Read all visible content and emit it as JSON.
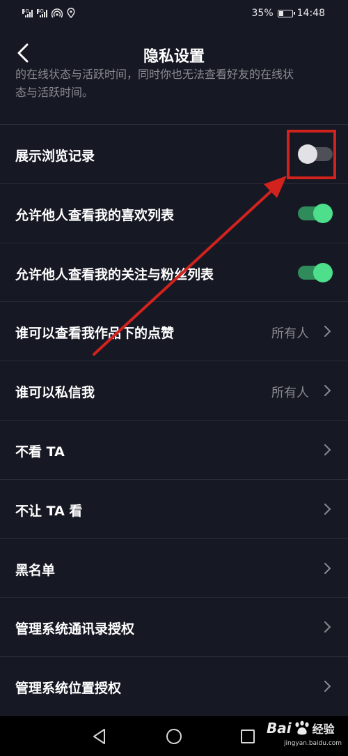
{
  "status_bar": {
    "signal_1_tag": "4G",
    "signal_2_tag": "4G",
    "battery_percent": "35%",
    "battery_level": 0.35,
    "time": "14:48"
  },
  "header": {
    "title": "隐私设置",
    "back_icon": "chevron-left-icon"
  },
  "description": {
    "partial_line": "的在线状态与活跃时间，同时你也无法查看好友的在线状",
    "line_2": "态与活跃时间。"
  },
  "settings": [
    {
      "label": "展示浏览记录",
      "type": "toggle",
      "on": false
    },
    {
      "label": "允许他人查看我的喜欢列表",
      "type": "toggle",
      "on": true
    },
    {
      "label": "允许他人查看我的关注与粉丝列表",
      "type": "toggle",
      "on": true
    },
    {
      "label": "谁可以查看我作品下的点赞",
      "type": "select",
      "value": "所有人"
    },
    {
      "label": "谁可以私信我",
      "type": "select",
      "value": "所有人"
    },
    {
      "label": "不看 TA",
      "type": "link"
    },
    {
      "label": "不让 TA 看",
      "type": "link"
    },
    {
      "label": "黑名单",
      "type": "link"
    },
    {
      "label": "管理系统通讯录授权",
      "type": "link"
    },
    {
      "label": "管理系统位置授权",
      "type": "link"
    }
  ],
  "colors": {
    "background": "#161823",
    "toggle_on": "#4ddf8b",
    "annotation_red": "#d2221d"
  },
  "watermark": {
    "brand": "Bai",
    "brand_suffix": "经验",
    "url": "jingyan.baidu.com"
  }
}
